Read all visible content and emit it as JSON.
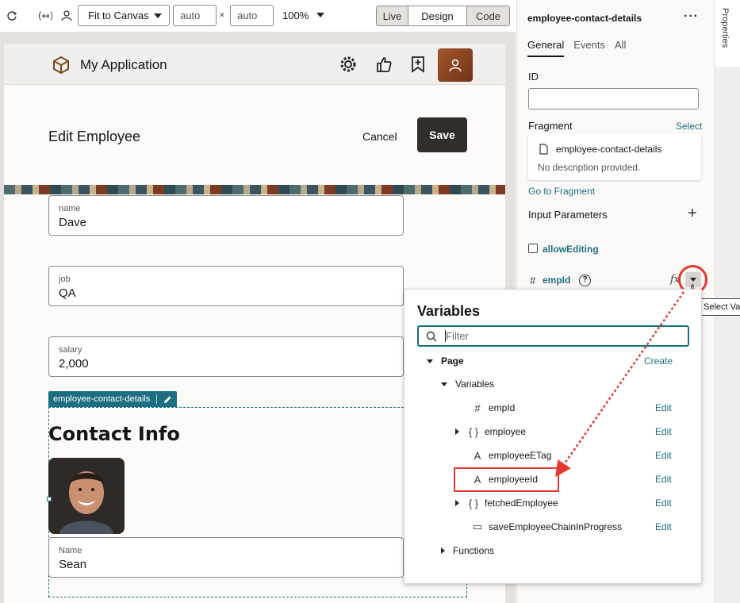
{
  "toolbar": {
    "fit_select": "Fit to Canvas",
    "width_value": "auto",
    "height_value": "auto",
    "times": "×",
    "zoom": "100%",
    "modes": [
      {
        "label": "Live",
        "active": false
      },
      {
        "label": "Design",
        "active": true
      },
      {
        "label": "Code",
        "active": false
      }
    ]
  },
  "app": {
    "title": "My Application",
    "page_title": "Edit Employee",
    "cancel": "Cancel",
    "save": "Save",
    "fields": [
      {
        "label": "name",
        "value": "Dave"
      },
      {
        "label": "job",
        "value": "QA"
      },
      {
        "label": "salary",
        "value": "2,000"
      }
    ],
    "fragment_tag": "employee-contact-details",
    "contact_title": "Contact Info",
    "contact_field": {
      "label": "Name",
      "value": "Sean"
    }
  },
  "properties": {
    "tab_label": "Properties",
    "title": "employee-contact-details",
    "tabs": [
      {
        "label": "General",
        "active": true
      },
      {
        "label": "Events",
        "active": false
      },
      {
        "label": "All",
        "active": false
      }
    ],
    "id_label": "ID",
    "fragment_label": "Fragment",
    "select_link": "Select",
    "fragment_name": "employee-contact-details",
    "fragment_desc": "No description provided.",
    "go_to_fragment": "Go to Fragment",
    "input_params": "Input Parameters",
    "allow_editing": "allowEditing",
    "emp_id_param": "empId",
    "fx": "fx",
    "tooltip": "Select Va"
  },
  "variables_popup": {
    "title": "Variables",
    "filter_placeholder": "Filter",
    "page_label": "Page",
    "create_link": "Create",
    "variables_label": "Variables",
    "edit_label": "Edit",
    "items": [
      {
        "icon": "#",
        "name": "empId",
        "expandable": false
      },
      {
        "icon": "{ }",
        "name": "employee",
        "expandable": true
      },
      {
        "icon": "A",
        "name": "employeeETag",
        "expandable": false
      },
      {
        "icon": "A",
        "name": "employeeId",
        "expandable": false
      },
      {
        "icon": "{ }",
        "name": "fetchedEmployee",
        "expandable": true
      },
      {
        "icon": "▭",
        "name": "saveEmployeeChainInProgress",
        "expandable": false
      }
    ],
    "functions_label": "Functions"
  },
  "colors": {
    "accent": "#1d6e80",
    "annotation_red": "#e8372f",
    "save_button": "#312d2a"
  }
}
